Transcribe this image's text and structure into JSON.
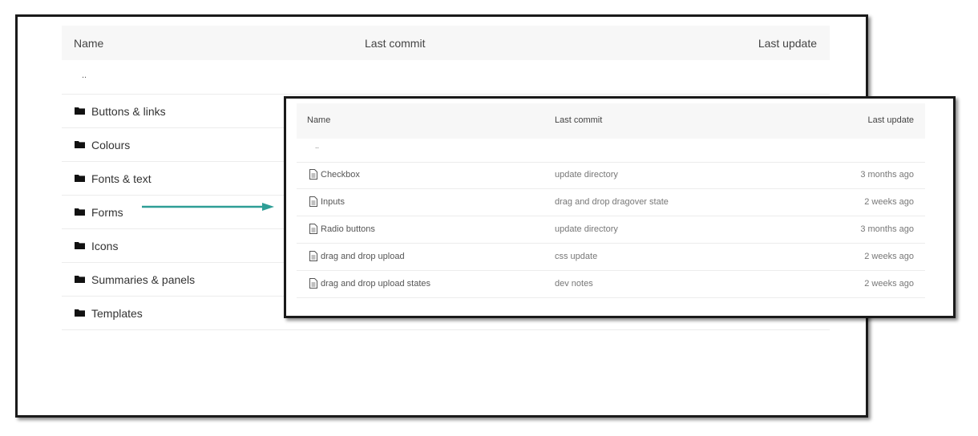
{
  "back": {
    "header": {
      "name": "Name",
      "last_commit": "Last commit",
      "last_update": "Last update"
    },
    "parent": "..",
    "folders": [
      {
        "label": "Buttons & links"
      },
      {
        "label": "Colours"
      },
      {
        "label": "Fonts & text"
      },
      {
        "label": "Forms"
      },
      {
        "label": "Icons"
      },
      {
        "label": "Summaries & panels"
      },
      {
        "label": "Templates"
      }
    ]
  },
  "front": {
    "header": {
      "name": "Name",
      "last_commit": "Last commit",
      "last_update": "Last update"
    },
    "parent": "..",
    "files": [
      {
        "name": "Checkbox",
        "commit": "update directory",
        "update": "3 months ago"
      },
      {
        "name": "Inputs",
        "commit": "drag and drop dragover state",
        "update": "2 weeks ago"
      },
      {
        "name": "Radio buttons",
        "commit": "update directory",
        "update": "3 months ago"
      },
      {
        "name": "drag and drop upload",
        "commit": "css update",
        "update": "2 weeks ago"
      },
      {
        "name": "drag and drop upload states",
        "commit": "dev notes",
        "update": "2 weeks ago"
      }
    ]
  },
  "colors": {
    "arrow": "#2e9e96",
    "frame": "#1a1a1a",
    "header_bg": "#f7f7f7"
  },
  "icons": {
    "folder": "folder-icon",
    "file": "file-icon"
  }
}
